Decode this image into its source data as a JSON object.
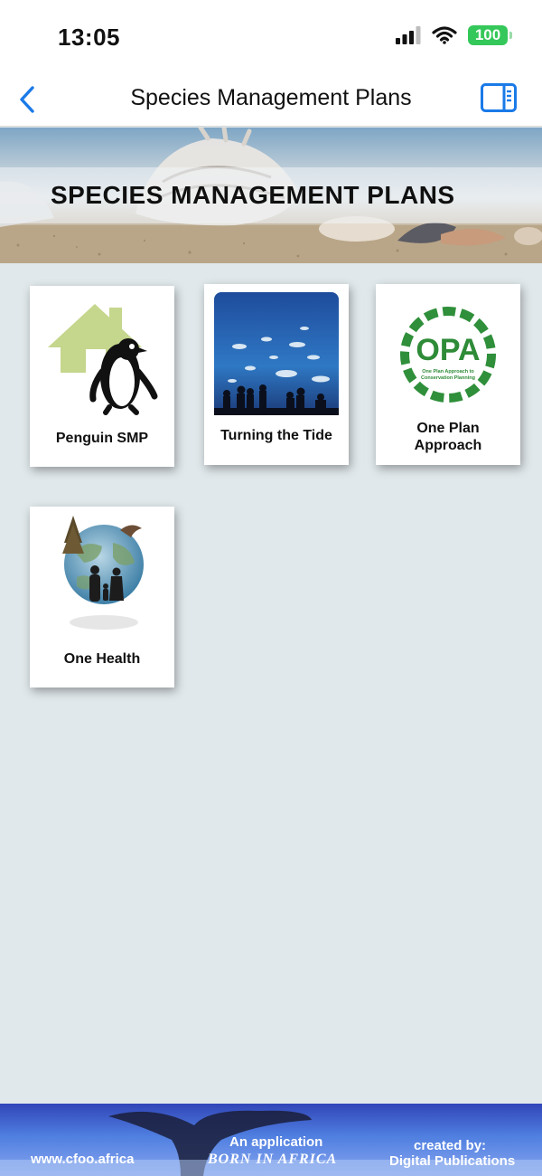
{
  "status": {
    "time": "13:05",
    "battery": "100"
  },
  "nav": {
    "title": "Species Management Plans",
    "back_icon": "chevron-left-icon",
    "sidebar_icon": "sidebar-icon"
  },
  "banner": {
    "title": "SPECIES MANAGEMENT PLANS"
  },
  "tiles": [
    {
      "label": "Penguin SMP",
      "icon": "penguin-house-icon"
    },
    {
      "label": "Turning the Tide",
      "icon": "aquarium-image"
    },
    {
      "label_line1": "One Plan",
      "label_line2": "Approach",
      "logo_text": "OPA",
      "logo_subtext_line1": "One Plan Approach to",
      "logo_subtext_line2": "Conservation Planning"
    },
    {
      "label": "One Health",
      "icon": "globe-family-icon"
    }
  ],
  "footer": {
    "website": "www.cfoo.africa",
    "application": "An application",
    "born": "BORN IN AFRICA",
    "created_by": "created by:",
    "publisher": "Digital Publications"
  },
  "colors": {
    "accent": "#1a7ae8",
    "background": "#e0e8eb",
    "battery": "#34c759",
    "footer": "#4f7fe0"
  }
}
